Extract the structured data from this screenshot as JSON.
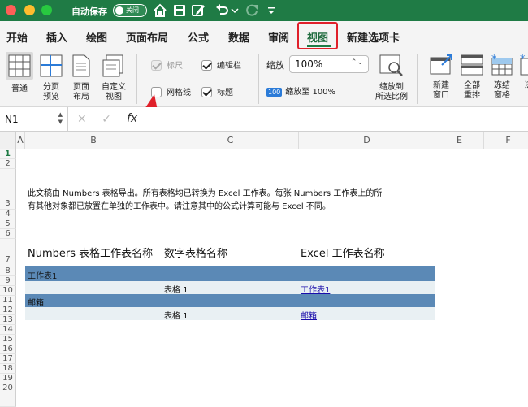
{
  "titlebar": {
    "autosave_label": "自动保存",
    "autosave_state": "关闭",
    "quick_access_icons": [
      "home-icon",
      "save-icon",
      "edit-icon",
      "undo-icon",
      "chevron-down-icon",
      "redo-icon",
      "customize-icon"
    ]
  },
  "tabs": [
    "开始",
    "插入",
    "绘图",
    "页面布局",
    "公式",
    "数据",
    "审阅",
    "视图",
    "新建选项卡"
  ],
  "active_tab": "视图",
  "ribbon": {
    "views": [
      {
        "label": "普通",
        "icon": "normal-view-icon"
      },
      {
        "label": "分页\n预览",
        "icon": "page-break-preview-icon"
      },
      {
        "label": "页面\n布局",
        "icon": "page-layout-icon"
      },
      {
        "label": "自定义\n视图",
        "icon": "custom-views-icon"
      }
    ],
    "show": {
      "ruler": {
        "label": "标尺",
        "checked": true,
        "disabled": true
      },
      "formula_bar": {
        "label": "编辑栏",
        "checked": true
      },
      "gridlines": {
        "label": "网格线",
        "checked": false
      },
      "headings": {
        "label": "标题",
        "checked": true
      }
    },
    "zoom": {
      "label": "缩放",
      "value": "100%",
      "zoom_100_badge": "100",
      "zoom_100_label": "缩放至 100%",
      "zoom_to_selection": "缩放到\n所选比例"
    },
    "window": [
      {
        "label": "新建\n窗口",
        "icon": "new-window-icon"
      },
      {
        "label": "全部\n重排",
        "icon": "arrange-all-icon"
      },
      {
        "label": "冻结\n窗格",
        "icon": "freeze-panes-icon"
      },
      {
        "label": "冻",
        "icon": "freeze-icon"
      }
    ]
  },
  "formula_bar": {
    "name_box": "N1",
    "fx": "fx",
    "cancel": "✕",
    "confirm": "✓"
  },
  "grid": {
    "columns": [
      "A",
      "B",
      "C",
      "D",
      "E",
      "F"
    ],
    "rows": [
      "1",
      "2",
      "3",
      "4",
      "5",
      "6",
      "7",
      "8",
      "9",
      "10",
      "11",
      "12",
      "13",
      "14",
      "15",
      "16",
      "17",
      "18",
      "19",
      "20"
    ],
    "selected_row": "1",
    "note_line1": "此文稿由 Numbers 表格导出。所有表格均已转换为 Excel 工作表。每张 Numbers 工作表上的所",
    "note_line2": "有其他对象都已放置在单独的工作表中。请注意其中的公式计算可能与 Excel 不同。",
    "headers": [
      "Numbers 表格工作表名称",
      "数字表格名称",
      "Excel 工作表名称"
    ],
    "sections": [
      {
        "sheet": "工作表1",
        "table": "表格 1",
        "excel": "工作表1"
      },
      {
        "sheet": "邮箱",
        "table": "表格 1",
        "excel": "邮箱"
      }
    ]
  },
  "colors": {
    "brand": "#1f7b45",
    "band": "#5b89b6",
    "band_light": "#e9f0f3",
    "annotation": "#e0202a"
  }
}
